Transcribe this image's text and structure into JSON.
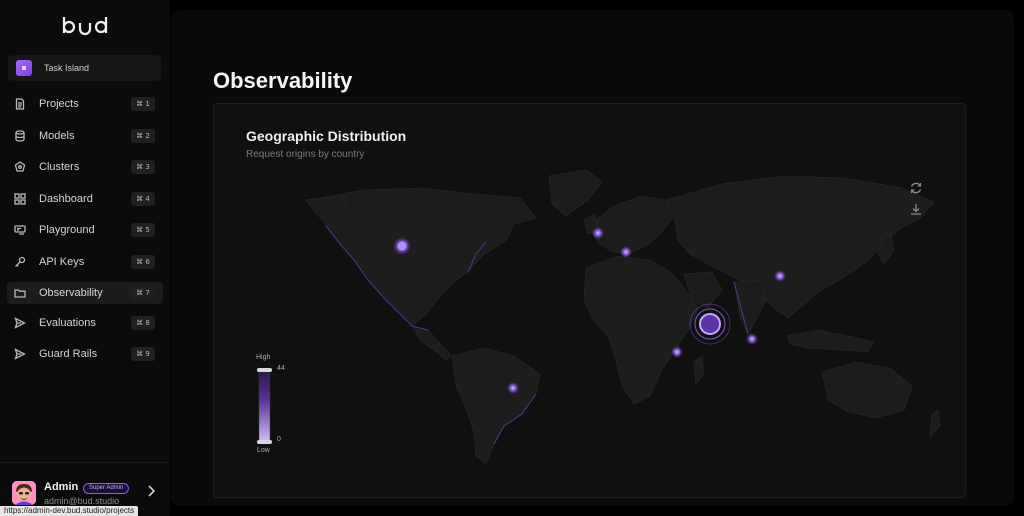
{
  "sidebar": {
    "logo_text": "bud",
    "task_island": {
      "label": "Task Island"
    },
    "items": [
      {
        "label": "Projects",
        "shortcut": "⌘ 1",
        "icon": "file-icon"
      },
      {
        "label": "Models",
        "shortcut": "⌘ 2",
        "icon": "database-icon"
      },
      {
        "label": "Clusters",
        "shortcut": "⌘ 3",
        "icon": "cluster-icon"
      },
      {
        "label": "Dashboard",
        "shortcut": "⌘ 4",
        "icon": "grid-icon"
      },
      {
        "label": "Playground",
        "shortcut": "⌘ 5",
        "icon": "playground-icon"
      },
      {
        "label": "API Keys",
        "shortcut": "⌘ 6",
        "icon": "key-icon"
      },
      {
        "label": "Observability",
        "shortcut": "⌘ 7",
        "icon": "folder-icon",
        "active": true
      },
      {
        "label": "Evaluations",
        "shortcut": "⌘ 8",
        "icon": "send-icon"
      },
      {
        "label": "Guard Rails",
        "shortcut": "⌘ 9",
        "icon": "send-icon"
      }
    ]
  },
  "user": {
    "name": "Admin",
    "role": "Super Admin",
    "email": "admin@bud.studio"
  },
  "status_bar": {
    "url": "https://admin-dev.bud.studio/projects"
  },
  "main": {
    "title": "Observability",
    "card": {
      "title": "Geographic Distribution",
      "subtitle": "Request origins by country",
      "legend": {
        "high_label": "High",
        "low_label": "Low",
        "max": "44",
        "min": "0"
      }
    }
  },
  "colors": {
    "accent": "#9b6bff",
    "background": "#000000",
    "panel": "#0a0a0a",
    "card": "#101010",
    "land": "#1d1d1d"
  }
}
